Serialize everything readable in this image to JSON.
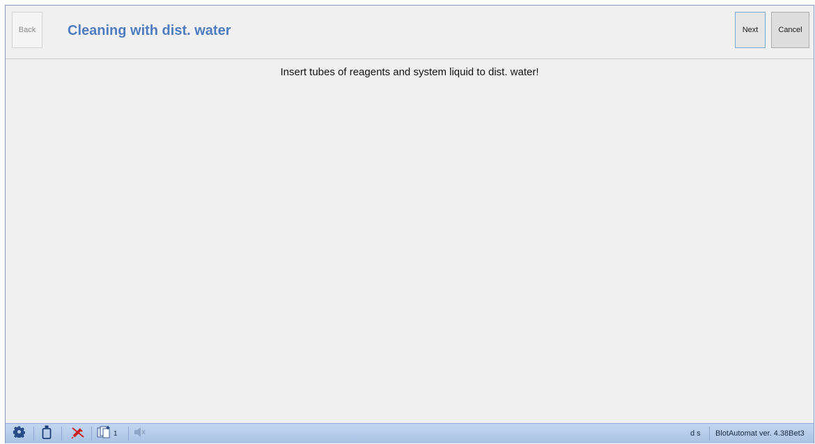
{
  "header": {
    "back_label": "Back",
    "title": "Cleaning with dist. water",
    "next_label": "Next",
    "cancel_label": "Cancel"
  },
  "main": {
    "message": "Insert tubes of reagents and system liquid to dist. water!"
  },
  "statusbar": {
    "icons": [
      "gear-icon",
      "bottle-icon",
      "syringe-disabled-icon",
      "copies-icon",
      "speaker-muted-icon"
    ],
    "copies_count": "1",
    "user_initials": "d s",
    "version": "BlotAutomat ver. 4.38Bet3"
  },
  "colors": {
    "title": "#4e7cbf",
    "statusbar": "#b4cbe8",
    "accent_red": "#cc1f1f"
  }
}
